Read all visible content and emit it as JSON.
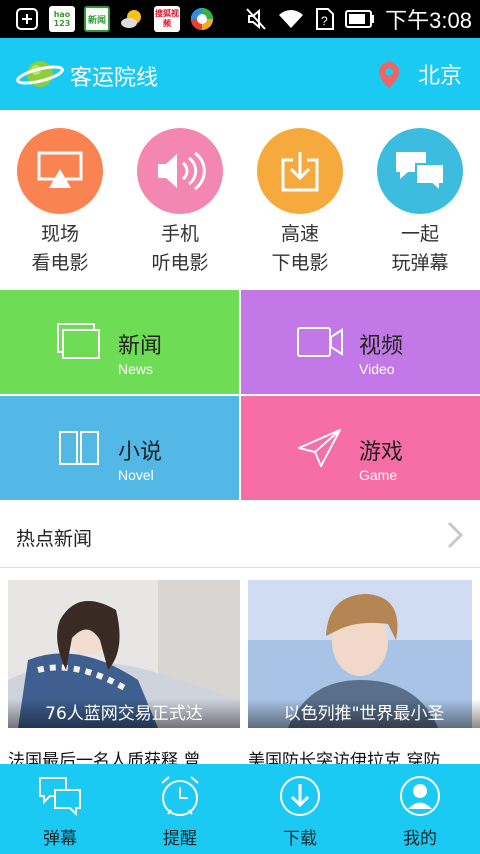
{
  "status_bar": {
    "notif_icons": [
      "plus-square-icon",
      "hao123-icon",
      "news-icon",
      "weather-icon",
      "sohu-video-icon",
      "market-icon"
    ],
    "hao123_label": "hao 123",
    "news_label": "新闻",
    "video_label": "搜狐视频",
    "time": "下午3:08"
  },
  "header": {
    "title": "客运院线",
    "city": "北京"
  },
  "features": [
    {
      "line1": "现场",
      "line2": "看电影",
      "color": "#fb8251",
      "icon": "screen-icon"
    },
    {
      "line1": "手机",
      "line2": "听电影",
      "color": "#f387b2",
      "icon": "speaker-icon"
    },
    {
      "line1": "高速",
      "line2": "下电影",
      "color": "#f6aa3d",
      "icon": "download-icon"
    },
    {
      "line1": "一起",
      "line2": "玩弹幕",
      "color": "#3cbde0",
      "icon": "chat-icon"
    }
  ],
  "categories": [
    {
      "cn": "新闻",
      "en": "News",
      "color": "#6fdc56"
    },
    {
      "cn": "视频",
      "en": "Video",
      "color": "#c278e6"
    },
    {
      "cn": "小说",
      "en": "Novel",
      "color": "#54b8e6"
    },
    {
      "cn": "游戏",
      "en": "Game",
      "color": "#f76da5"
    }
  ],
  "hot_news": {
    "title": "热点新闻"
  },
  "news_cards": [
    {
      "caption": "76人蓝网交易正式达",
      "headline": "法国最后一名人质获释 曾..."
    },
    {
      "caption": "以色列推\"世界最小圣",
      "headline": "美国防长突访伊拉克 穿防..."
    }
  ],
  "bottom_nav": [
    {
      "label": "弹幕",
      "icon": "chat-bubble-icon"
    },
    {
      "label": "提醒",
      "icon": "alarm-clock-icon"
    },
    {
      "label": "下载",
      "icon": "download-circle-icon"
    },
    {
      "label": "我的",
      "icon": "profile-icon"
    }
  ],
  "colors": {
    "primary": "#1bcaf3"
  }
}
